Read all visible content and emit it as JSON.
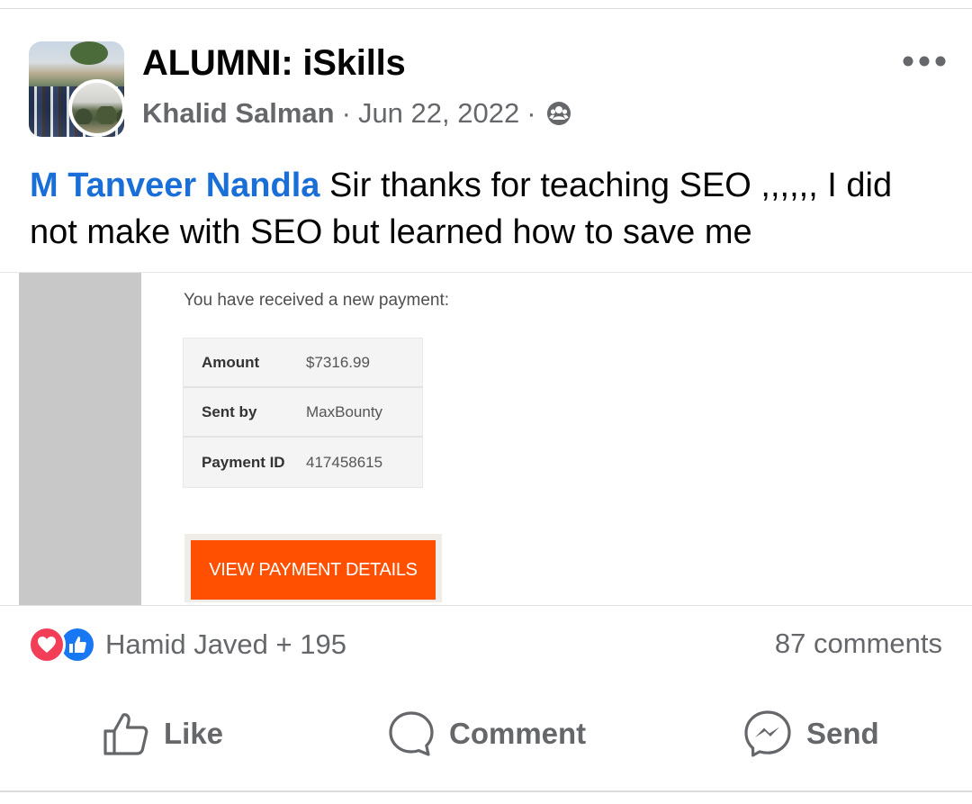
{
  "post": {
    "group_name": "ALUMNI: iSkills",
    "author": "Khalid Salman",
    "separator": "·",
    "date": "Jun 22, 2022",
    "privacy_icon": "group-members-icon",
    "more_icon": "more-dots-icon",
    "mention": "M Tanveer Nandla",
    "body": " Sir thanks for teaching SEO ,,,,,, I did not make with SEO but learned how to save me"
  },
  "attachment": {
    "heading": "You have received a new payment:",
    "rows": [
      {
        "key": "Amount",
        "value": "$7316.99"
      },
      {
        "key": "Sent by",
        "value": "MaxBounty"
      },
      {
        "key": "Payment ID",
        "value": "417458615"
      }
    ],
    "button_label": "VIEW PAYMENT DETAILS",
    "button_color": "#fe5000"
  },
  "engagement": {
    "reaction_icons": [
      "love-reaction-icon",
      "like-reaction-icon"
    ],
    "reactors": "Hamid Javed + 195",
    "comments": "87 comments"
  },
  "actions": {
    "like": "Like",
    "comment": "Comment",
    "send": "Send"
  },
  "colors": {
    "link_blue": "#1a6ed8",
    "secondary_text": "#65676b",
    "love_red": "#f33e58",
    "like_blue": "#1877f2"
  }
}
